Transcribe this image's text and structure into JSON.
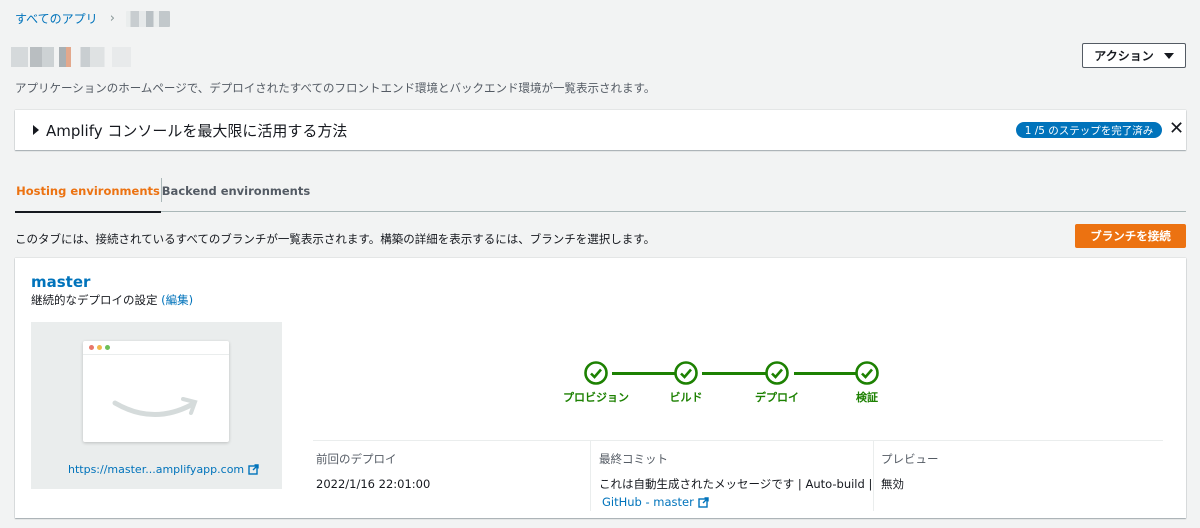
{
  "breadcrumb": {
    "root": "すべてのアプリ"
  },
  "header": {
    "description": "アプリケーションのホームページで、デプロイされたすべてのフロントエンド環境とバックエンド環境が一覧表示されます。",
    "action_label": "アクション"
  },
  "guide": {
    "title": "Amplify コンソールを最大限に活用する方法",
    "progress": "1 /5 のステップを完了済み"
  },
  "tabs": [
    {
      "label": "Hosting environments"
    },
    {
      "label": "Backend environments"
    }
  ],
  "info": {
    "text": "このタブには、接続されているすべてのブランチが一覧表示されます。構築の詳細を表示するには、ブランチを選択します。",
    "connect_label": "ブランチを接続"
  },
  "branch": {
    "name": "master",
    "deploy_setting": "継続的なデプロイの設定",
    "edit_label": "(編集)",
    "url": "https://master...amplifyapp.com",
    "steps": [
      {
        "label": "プロビジョン"
      },
      {
        "label": "ビルド"
      },
      {
        "label": "デプロイ"
      },
      {
        "label": "検証"
      }
    ],
    "summary": {
      "last_deploy_head": "前回のデプロイ",
      "last_deploy_value": "2022/1/16 22:01:00",
      "last_commit_head": "最終コミット",
      "last_commit_value": "これは自動生成されたメッセージです | Auto-build |",
      "last_commit_link": "GitHub - master",
      "preview_head": "プレビュー",
      "preview_value": "無効"
    }
  },
  "colors": {
    "accent": "#ec7211",
    "link": "#0073bb",
    "success": "#1d8102"
  }
}
